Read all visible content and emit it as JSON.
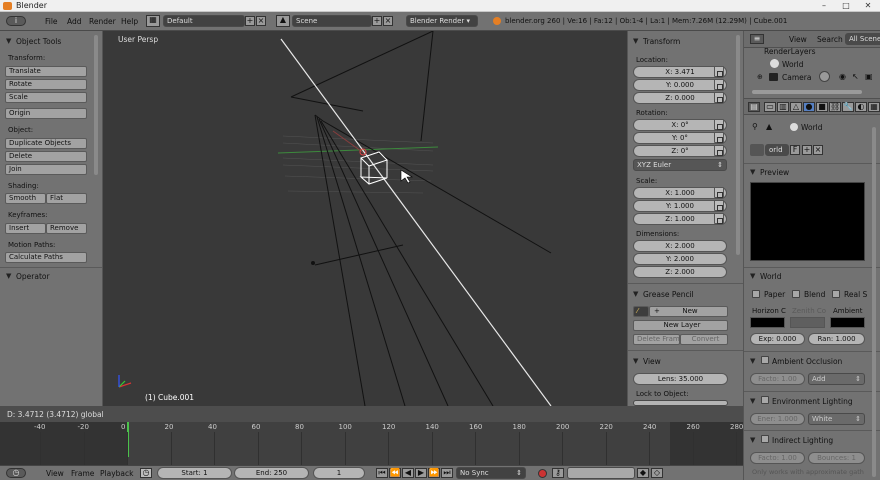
{
  "window": {
    "title": "Blender",
    "controls": [
      "–",
      "□",
      "✕"
    ]
  },
  "topbar": {
    "menus": [
      "File",
      "Add",
      "Render",
      "Help"
    ],
    "layout": "Default",
    "scene": "Scene",
    "engine": "Blender Render",
    "stats": "blender.org 260 | Ve:16 | Fa:12 | Ob:1-4 | La:1 | Mem:7.26M (12.29M) | Cube.001"
  },
  "toolshelf": {
    "title": "Object Tools",
    "transform_label": "Transform:",
    "transform": [
      "Translate",
      "Rotate",
      "Scale"
    ],
    "origin": "Origin",
    "object_label": "Object:",
    "object": [
      "Duplicate Objects",
      "Delete",
      "Join"
    ],
    "shading_label": "Shading:",
    "shading": [
      "Smooth",
      "Flat"
    ],
    "keyframes_label": "Keyframes:",
    "keyframes": [
      "Insert",
      "Remove"
    ],
    "motion_label": "Motion Paths:",
    "motion": "Calculate Paths",
    "operator": "Operator"
  },
  "viewport": {
    "view_name": "User Persp",
    "object_name": "(1) Cube.001"
  },
  "npanel": {
    "title": "Transform",
    "location_label": "Location:",
    "location": [
      "X: 3.471",
      "Y: 0.000",
      "Z: 0.000"
    ],
    "rotation_label": "Rotation:",
    "rotation": [
      "X: 0°",
      "Y: 0°",
      "Z: 0°"
    ],
    "rotation_mode": "XYZ Euler",
    "scale_label": "Scale:",
    "scale": [
      "X: 1.000",
      "Y: 1.000",
      "Z: 1.000"
    ],
    "dimensions_label": "Dimensions:",
    "dimensions": [
      "X: 2.000",
      "Y: 2.000",
      "Z: 2.000"
    ],
    "grease_title": "Grease Pencil",
    "grease_new": "New",
    "grease_new_layer": "New Layer",
    "grease_delete": "Delete Frame",
    "grease_convert": "Convert",
    "view_title": "View",
    "lens": "Lens: 35.000",
    "lock_label": "Lock to Object:"
  },
  "outliner": {
    "view": "View",
    "search": "Search",
    "scope": "All Scenes",
    "items": [
      "RenderLayers",
      "World",
      "Camera"
    ]
  },
  "properties": {
    "breadcrumb": "World",
    "world_field": "orld",
    "world_f": "F",
    "preview_title": "Preview",
    "world_title": "World",
    "world_checks": [
      "Paper",
      "Blend",
      "Real S"
    ],
    "horizon": "Horizon C",
    "zenith": "Zenith Co",
    "ambient": "Ambient",
    "exposure": "Exp: 0.000",
    "range": "Ran: 1.000",
    "ao_title": "Ambient Occlusion",
    "ao_factor": "Facto: 1.00",
    "ao_mode": "Add",
    "env_title": "Environment Lighting",
    "env_energy": "Ener: 1.000",
    "env_color": "White",
    "indirect_title": "Indirect Lighting",
    "indirect_factor": "Facto: 1.00",
    "indirect_bounces": "Bounces: 1",
    "indirect_note": "Only works with approximate gath"
  },
  "status": {
    "text": "D: 3.4712 (3.4712) global"
  },
  "timeline": {
    "ticks": [
      "-40",
      "-20",
      "0",
      "20",
      "40",
      "60",
      "80",
      "100",
      "120",
      "140",
      "160",
      "180",
      "200",
      "220",
      "240",
      "260",
      "280"
    ],
    "current_frame": 1
  },
  "timebar": {
    "menus": [
      "View",
      "Frame",
      "Playback"
    ],
    "start": "Start: 1",
    "end": "End: 250",
    "current": "1",
    "sync": "No Sync"
  },
  "colors": {
    "panel": "#727272",
    "viewport": "#393939",
    "accent": "#e57f24",
    "timeline_cursor": "#4bc24b"
  }
}
